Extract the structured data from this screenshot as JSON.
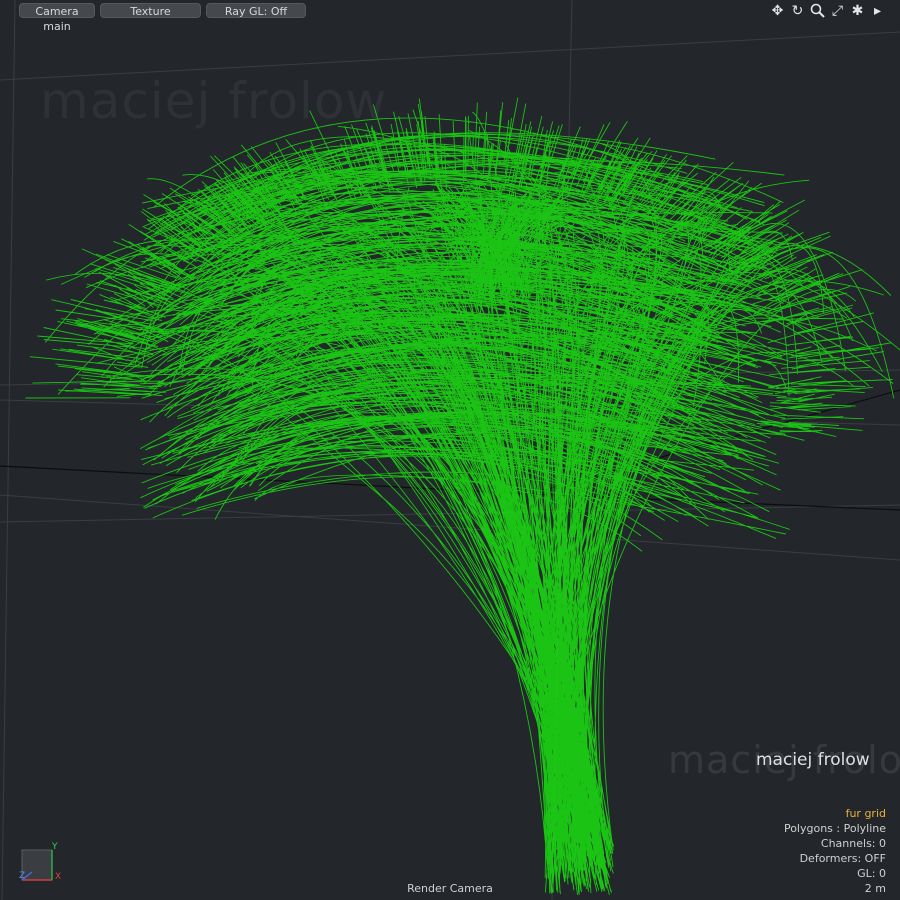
{
  "toolbar": {
    "camera_label": "Camera main",
    "shading_label": "Texture",
    "raygl_label": "Ray GL: Off"
  },
  "view_tools": [
    "move-icon",
    "rotate-icon",
    "zoom-icon",
    "fit-icon",
    "gear-icon",
    "arrow-right-icon"
  ],
  "watermark": {
    "text": "maciej frolow"
  },
  "info": {
    "selection": "fur grid",
    "polygons": "Polygons : Polyline",
    "channels": "Channels: 0",
    "deformers": "Deformers: OFF",
    "gl": "GL: 0",
    "scale": "2 m"
  },
  "camera_name": "Render Camera",
  "gizmo": {
    "y": "Y",
    "x": "X",
    "z": "Z"
  },
  "colors": {
    "fur": "#1adf10",
    "background": "#23262b",
    "selection": "#e8b23a"
  }
}
